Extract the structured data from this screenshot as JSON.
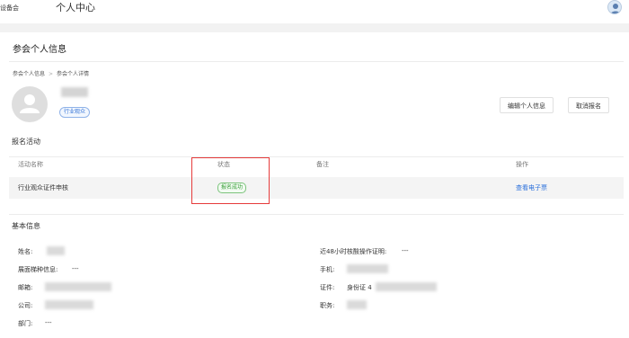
{
  "header": {
    "brand": "i设备会",
    "title": "个人中心"
  },
  "page": {
    "title": "参会个人信息",
    "breadcrumb": [
      "参会个人信息",
      "参会个人详情"
    ],
    "breadcrumb_sep": ">"
  },
  "profile": {
    "tag": "行业观众",
    "edit_button": "编辑个人信息",
    "cancel_button": "取消报名"
  },
  "registration": {
    "title": "报名活动",
    "columns": [
      "活动名称",
      "状态",
      "备注",
      "操作"
    ],
    "rows": [
      {
        "activity": "行业观众证件申核",
        "status": "报名成功",
        "note": "",
        "action": "查看电子票"
      }
    ]
  },
  "basic_info": {
    "title": "基本信息",
    "name_label": "姓名:",
    "nucleic_label": "近48小时核酸操作证明:",
    "nucleic_value": "---",
    "seat_label": "展面梯种信息:",
    "seat_value": "---",
    "phone_label": "手机:",
    "email_label": "邮箱:",
    "id_label": "证件:",
    "id_value_prefix": "身份证 4",
    "company_label": "公司:",
    "position_label": "职务:",
    "dept_label": "部门:",
    "dept_value": "---"
  },
  "colors": {
    "accent": "#2a6fdb",
    "success": "#3a9e3a",
    "highlight": "#e63b3b"
  }
}
